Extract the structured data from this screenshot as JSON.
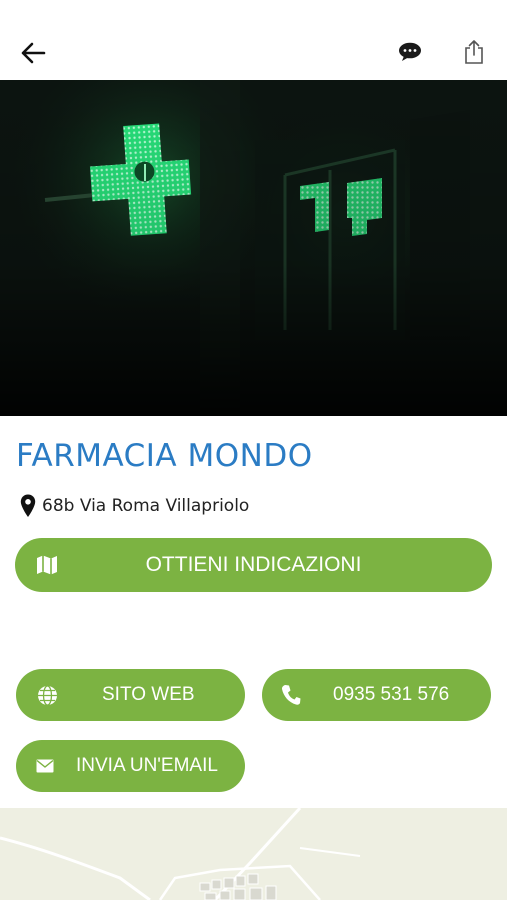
{
  "header": {
    "back_icon": "arrow-left-icon",
    "chat_icon": "chat-bubble-icon",
    "share_icon": "share-icon"
  },
  "hero": {
    "image": "green pharmacy cross sign at night"
  },
  "place": {
    "title": "FARMACIA  MONDO",
    "address_icon": "map-pin-icon",
    "address": "68b Via  Roma Villapriolo"
  },
  "actions": {
    "directions_label": "OTTIENI INDICAZIONI",
    "directions_icon": "map-icon",
    "website_label": "SITO WEB",
    "website_icon": "globe-icon",
    "phone_label": "0935 531 576",
    "phone_icon": "phone-icon",
    "email_label": "INVIA UN'EMAIL",
    "email_icon": "envelope-icon"
  },
  "colors": {
    "accent_green": "#7cb342",
    "title_blue": "#2b7cc4",
    "map_bg": "#eeefe2"
  }
}
